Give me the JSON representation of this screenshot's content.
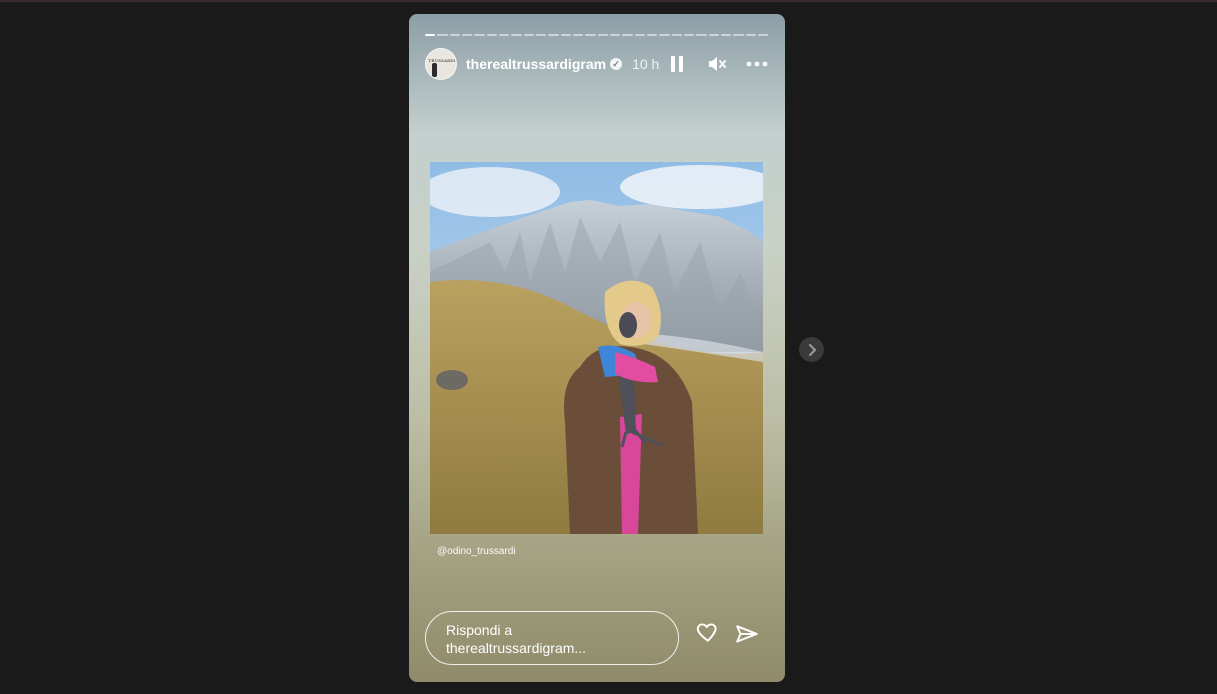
{
  "story": {
    "username": "therealtrussardigram",
    "time": "10 h",
    "avatar_text": "TRUSSARDI",
    "progress_segments": 28,
    "mention": "@odino_trussardi",
    "reply_placeholder_line1": "Rispondi a",
    "reply_placeholder_line2": "therealtrussardigram..."
  },
  "icons": {
    "verified": "verified-badge-icon",
    "pause": "pause-icon",
    "mute": "muted-speaker-icon",
    "more": "more-options-icon",
    "like": "heart-icon",
    "share": "send-icon",
    "next": "chevron-right-icon"
  },
  "colors": {
    "page_background": "#1a1a1a",
    "text": "#ffffff"
  }
}
